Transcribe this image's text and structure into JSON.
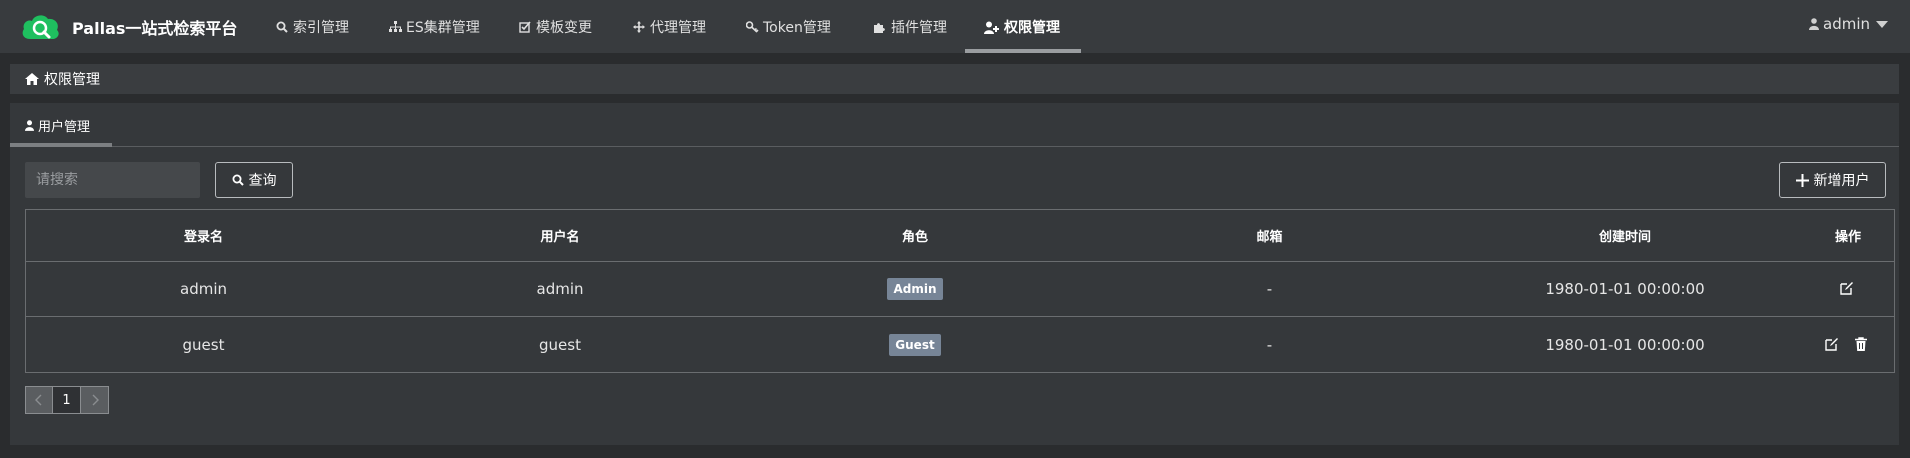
{
  "app": {
    "brand_name": "Pallas一站式检索平台",
    "accent_color": "#1fbf5f"
  },
  "nav": {
    "items": [
      {
        "label": "索引管理",
        "icon": "search-icon"
      },
      {
        "label": "ES集群管理",
        "icon": "sitemap-icon"
      },
      {
        "label": "模板变更",
        "icon": "checkbox-icon"
      },
      {
        "label": "代理管理",
        "icon": "arrows-icon"
      },
      {
        "label": "Token管理",
        "icon": "key-icon"
      },
      {
        "label": "插件管理",
        "icon": "puzzle-icon"
      },
      {
        "label": "权限管理",
        "icon": "user-plus-icon",
        "active": true
      }
    ],
    "user": "admin"
  },
  "breadcrumb": {
    "label": "权限管理"
  },
  "tabs": [
    {
      "label": "用户管理",
      "active": true
    }
  ],
  "toolbar": {
    "search_placeholder": "请搜索",
    "search_value": "",
    "query_label": "查询",
    "add_label": "新增用户"
  },
  "table": {
    "headers": [
      "登录名",
      "用户名",
      "角色",
      "邮箱",
      "创建时间",
      "操作"
    ],
    "rows": [
      {
        "login": "admin",
        "username": "admin",
        "role": "Admin",
        "email": "-",
        "created": "1980-01-01 00:00:00",
        "actions": [
          "edit-icon"
        ]
      },
      {
        "login": "guest",
        "username": "guest",
        "role": "Guest",
        "email": "-",
        "created": "1980-01-01 00:00:00",
        "actions": [
          "edit-icon",
          "trash-icon"
        ]
      }
    ]
  },
  "pagination": {
    "current_page": "1"
  }
}
